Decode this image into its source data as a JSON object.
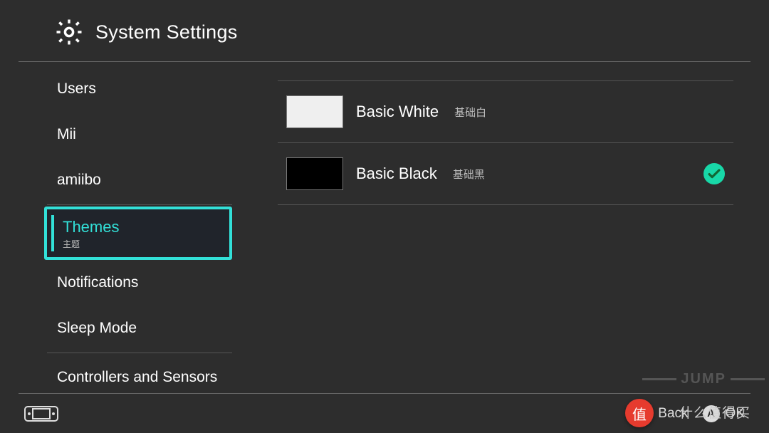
{
  "header": {
    "title": "System Settings"
  },
  "sidebar": {
    "items": [
      {
        "label": "Users"
      },
      {
        "label": "Mii"
      },
      {
        "label": "amiibo"
      },
      {
        "label": "Themes",
        "sub": "主题",
        "selected": true
      },
      {
        "label": "Notifications"
      },
      {
        "label": "Sleep Mode"
      },
      {
        "label": "Controllers and Sensors"
      }
    ]
  },
  "themes": {
    "items": [
      {
        "label": "Basic White",
        "sub": "基础白",
        "swatch": "#efefef",
        "selected": false
      },
      {
        "label": "Basic Black",
        "sub": "基础黑",
        "swatch": "#000000",
        "selected": true
      }
    ]
  },
  "footer": {
    "back_glyph": "B",
    "back_label": "Back",
    "ok_glyph": "A",
    "ok_label": "OK"
  },
  "watermark": {
    "jump": "JUMP",
    "circle": "值",
    "text": "什么值得买"
  },
  "colors": {
    "accent": "#32e0d8",
    "background": "#2d2d2d"
  }
}
